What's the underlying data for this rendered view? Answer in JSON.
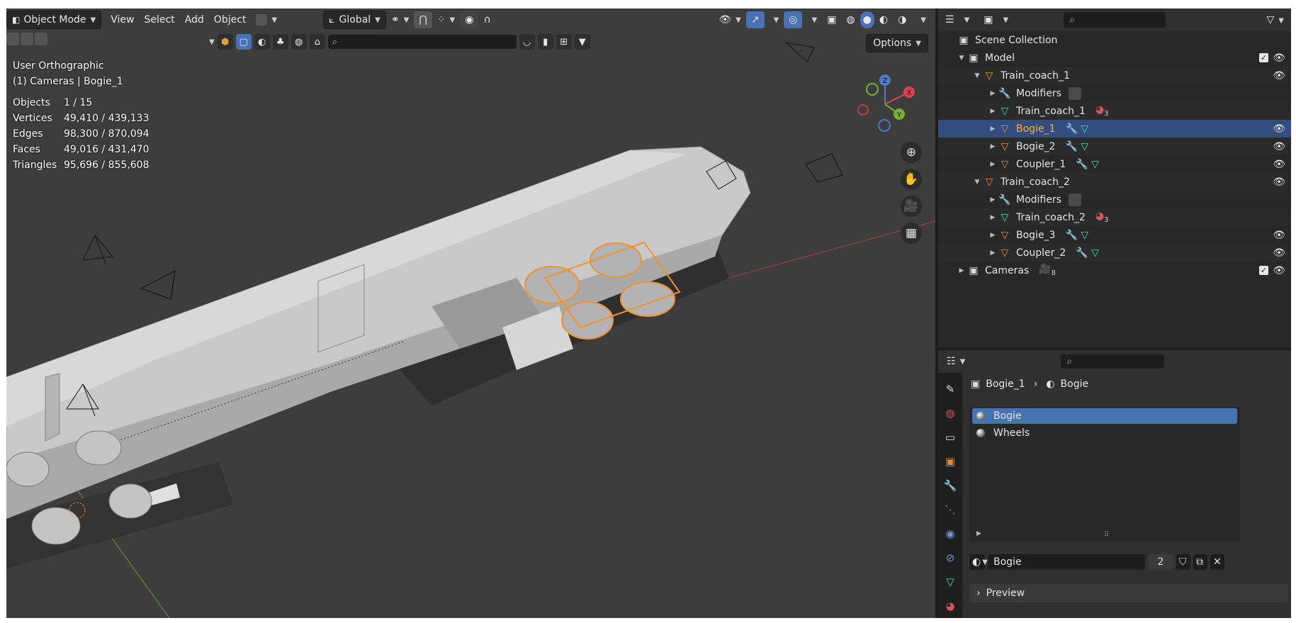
{
  "viewport": {
    "mode_label": "Object Mode",
    "menus": [
      "View",
      "Select",
      "Add",
      "Object"
    ],
    "transform_orientation": "Global",
    "options_label": "Options",
    "view_name": "User Orthographic",
    "context": "(1) Cameras | Bogie_1",
    "stats": [
      {
        "label": "Objects",
        "value": "1 / 15"
      },
      {
        "label": "Vertices",
        "value": "49,410 / 439,133"
      },
      {
        "label": "Edges",
        "value": "98,300 / 870,094"
      },
      {
        "label": "Faces",
        "value": "49,016 / 431,470"
      },
      {
        "label": "Triangles",
        "value": "95,696 / 855,608"
      }
    ],
    "gizmo": {
      "x": "X",
      "y": "Y",
      "z": "Z"
    }
  },
  "outliner": {
    "root": "Scene Collection",
    "rows": [
      {
        "label": "Model",
        "level": 1,
        "icon": "collection-icon",
        "tri": "▼",
        "check": true,
        "eye": true
      },
      {
        "label": "Train_coach_1",
        "level": 2,
        "icon": "object-empty-icon",
        "tri": "▼",
        "eye": true
      },
      {
        "label": "Modifiers",
        "level": 3,
        "icon": "wrench-icon",
        "tri": "▶",
        "eye": false
      },
      {
        "label": "Train_coach_1",
        "level": 3,
        "icon": "mesh-data-icon",
        "tri": "▶",
        "eye": false,
        "badge": "3"
      },
      {
        "label": "Bogie_1",
        "level": 3,
        "icon": "object-icon",
        "tri": "▶",
        "eye": true,
        "selected": true
      },
      {
        "label": "Bogie_2",
        "level": 3,
        "icon": "object-icon",
        "tri": "▶",
        "eye": true
      },
      {
        "label": "Coupler_1",
        "level": 3,
        "icon": "object-icon",
        "tri": "▶",
        "eye": true
      },
      {
        "label": "Train_coach_2",
        "level": 2,
        "icon": "object-empty-icon",
        "tri": "▼",
        "eye": true
      },
      {
        "label": "Modifiers",
        "level": 3,
        "icon": "wrench-icon",
        "tri": "▶",
        "eye": false
      },
      {
        "label": "Train_coach_2",
        "level": 3,
        "icon": "mesh-data-icon",
        "tri": "▶",
        "eye": false,
        "badge": "3"
      },
      {
        "label": "Bogie_3",
        "level": 3,
        "icon": "object-icon",
        "tri": "▶",
        "eye": true
      },
      {
        "label": "Coupler_2",
        "level": 3,
        "icon": "object-icon",
        "tri": "▶",
        "eye": true
      },
      {
        "label": "Cameras",
        "level": 1,
        "icon": "collection-icon",
        "tri": "▶",
        "check": true,
        "eye": true,
        "badge": "8"
      }
    ]
  },
  "properties": {
    "breadcrumb_object": "Bogie_1",
    "breadcrumb_material": "Bogie",
    "materials": [
      {
        "name": "Bogie",
        "selected": true
      },
      {
        "name": "Wheels",
        "selected": false
      }
    ],
    "material_name": "Bogie",
    "users_count": "2",
    "preview_label": "Preview"
  }
}
